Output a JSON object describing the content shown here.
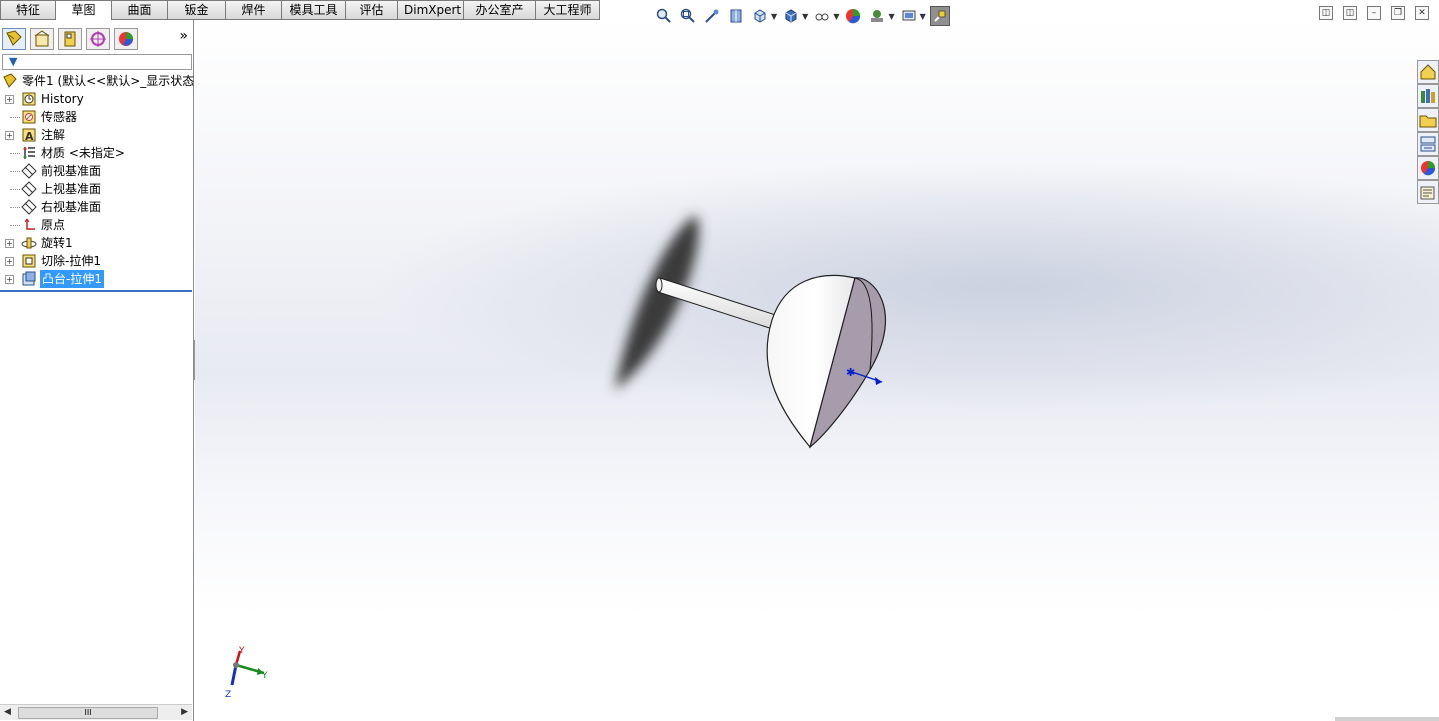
{
  "tabs": [
    "特征",
    "草图",
    "曲面",
    "钣金",
    "焊件",
    "模具工具",
    "评估",
    "DimXpert",
    "办公室产品",
    "大工程师"
  ],
  "active_tab": "草图",
  "panel": {
    "chevron": "»",
    "tabs": [
      "feature-manager-icon",
      "property-manager-icon",
      "configuration-manager-icon",
      "dimxpert-manager-icon",
      "display-manager-icon"
    ],
    "filter_icon": "filter-icon"
  },
  "tree": {
    "root": "零件1  (默认<<默认>_显示状态",
    "items": [
      {
        "label": "History",
        "icon": "history-icon",
        "expandable": true
      },
      {
        "label": "传感器",
        "icon": "sensor-icon",
        "expandable": false
      },
      {
        "label": "注解",
        "icon": "annotation-icon",
        "expandable": true
      },
      {
        "label": "材质 <未指定>",
        "icon": "material-icon",
        "expandable": false
      },
      {
        "label": "前视基准面",
        "icon": "plane-icon",
        "expandable": false
      },
      {
        "label": "上视基准面",
        "icon": "plane-icon",
        "expandable": false
      },
      {
        "label": "右视基准面",
        "icon": "plane-icon",
        "expandable": false
      },
      {
        "label": "原点",
        "icon": "origin-icon",
        "expandable": false
      },
      {
        "label": "旋转1",
        "icon": "revolve-icon",
        "expandable": true
      },
      {
        "label": "切除-拉伸1",
        "icon": "cut-extrude-icon",
        "expandable": true
      },
      {
        "label": "凸台-拉伸1",
        "icon": "boss-extrude-icon",
        "expandable": true,
        "selected": true
      }
    ]
  },
  "hscroll_thumb": "III",
  "triad": {
    "x": "Y",
    "y": "Y",
    "z": "Z"
  },
  "colors": {
    "selection": "#3399ff",
    "tree_rule": "#3a6fc4",
    "accent": "#1f5fb0"
  }
}
